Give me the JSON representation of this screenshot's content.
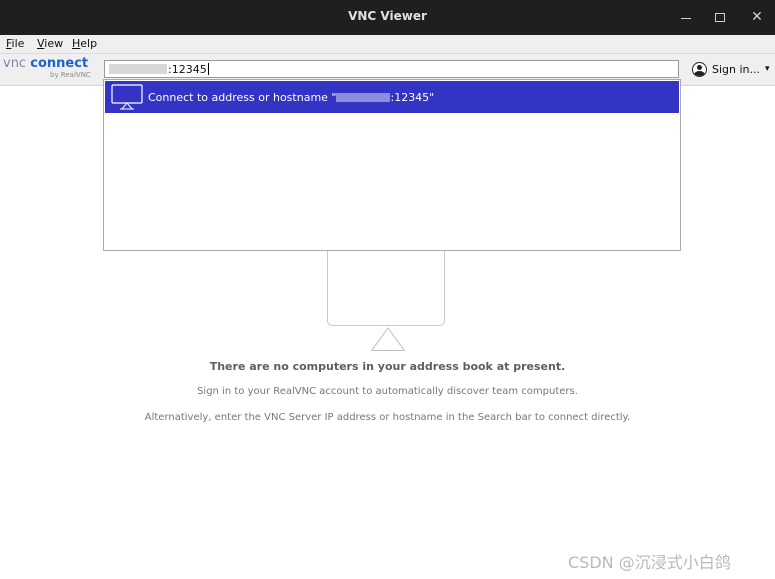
{
  "window": {
    "title": "VNC Viewer"
  },
  "menu": {
    "file": {
      "mnemonic": "F",
      "rest": "ile"
    },
    "view": {
      "mnemonic": "V",
      "rest": "iew"
    },
    "help": {
      "mnemonic": "H",
      "rest": "elp"
    }
  },
  "logo": {
    "vnc": "vnc",
    "connect": "connect",
    "by": "by RealVNC"
  },
  "search": {
    "value": ":12345",
    "redacted_prefix": true
  },
  "account": {
    "signin_label": "Sign in...",
    "arrow": "▾",
    "icon": "user-avatar-icon"
  },
  "suggestion": {
    "prefix": "Connect to address or hostname \"",
    "suffix": ":12345\"",
    "icon": "computer-monitor-icon"
  },
  "empty_state": {
    "line1": "There are no computers in your address book at present.",
    "line2": "Sign in to your RealVNC account to automatically discover team computers.",
    "line3": "Alternatively, enter the VNC Server IP address or hostname in the Search bar to connect directly."
  },
  "watermark": "CSDN @沉浸式小白鸽",
  "colors": {
    "titlebar": "#1f1f1f",
    "selection": "#3333c4",
    "brand_blue": "#1e63c6"
  }
}
